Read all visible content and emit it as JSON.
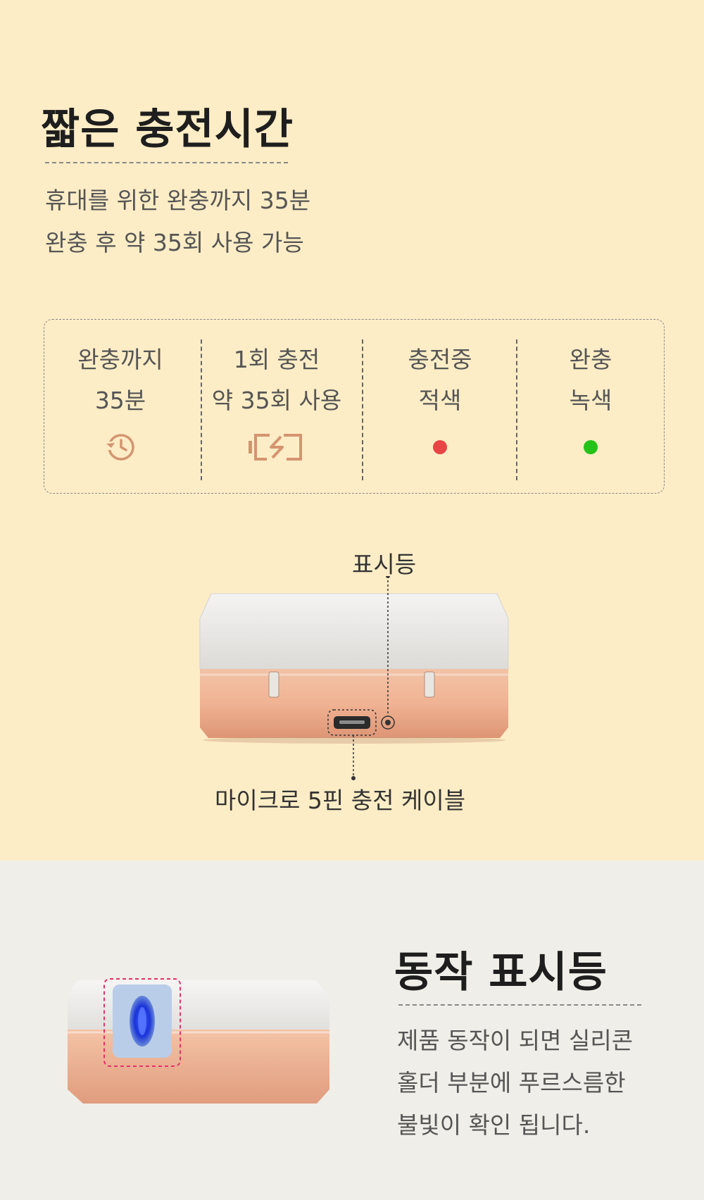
{
  "section1": {
    "title": "짧은 충전시간",
    "lines": [
      "휴대를 위한 완충까지 35분",
      "완충 후 약 35회 사용 가능"
    ]
  },
  "info": [
    {
      "line1": "완충까지",
      "line2": "35분",
      "icon": "clock-history-icon"
    },
    {
      "line1": "1회 충전",
      "line2": "약 35회 사용",
      "icon": "battery-charge-icon"
    },
    {
      "line1": "충전중",
      "line2": "적색",
      "icon": "red-dot-icon",
      "color": "#e84545"
    },
    {
      "line1": "완충",
      "line2": "녹색",
      "icon": "green-dot-icon",
      "color": "#25c219"
    }
  ],
  "device": {
    "indicator_label": "표시등",
    "port_label": "마이크로 5핀 충전 케이블"
  },
  "section2": {
    "title": "동작 표시등",
    "lines": [
      "제품 동작이 되면 실리콘",
      "홀더 부분에 푸르스름한",
      "불빛이 확인 됩니다."
    ]
  },
  "colors": {
    "top_bg": "#fdedc6",
    "bottom_bg": "#efeee8",
    "icon_accent": "#d49470",
    "highlight_dash": "#e0336c"
  }
}
